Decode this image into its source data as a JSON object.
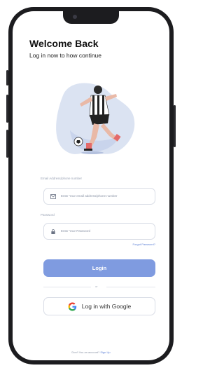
{
  "header": {
    "title": "Welcome Back",
    "subtitle": "Log in now to how continue"
  },
  "form": {
    "email_label": "Email Address/phone number",
    "email_placeholder": "Enter Your email address/phone number",
    "password_label": "Password",
    "password_placeholder": "Enter Your Password",
    "forgot_label": "Forgot Password?",
    "login_label": "Login",
    "divider_label": "or",
    "google_label": "Log in with Google"
  },
  "footer": {
    "prompt": "Don't You an account? ",
    "signup_label": "Sign Up"
  },
  "colors": {
    "accent": "#7f9be0",
    "link": "#5b7fd6",
    "blob": "#dbe3f2"
  },
  "icons": {
    "email": "email-icon",
    "password": "lock-icon",
    "google": "google-icon"
  }
}
